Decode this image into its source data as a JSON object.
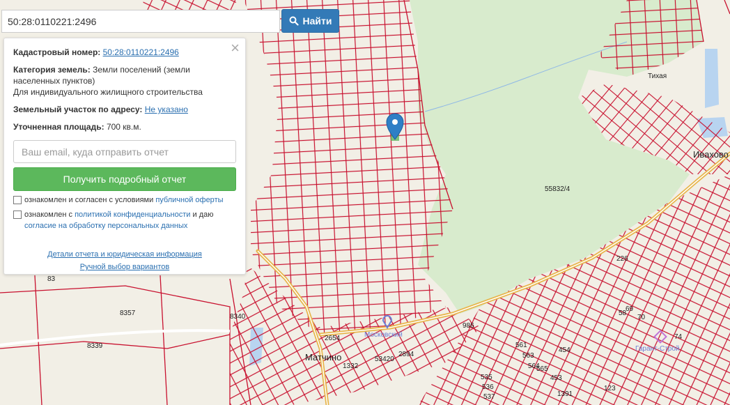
{
  "search": {
    "value": "50:28:0110221:2496",
    "button_label": "Найти"
  },
  "panel": {
    "close_glyph": "×",
    "cadastral_label": "Кадастровый номер:",
    "cadastral_value": "50:28:0110221:2496",
    "category_label": "Категория земель:",
    "category_value": "Земли поселений (земли населенных пунктов)",
    "category_use": "Для индивидуального жилищного строительства",
    "address_label": "Земельный участок по адресу:",
    "address_value": "Не указано",
    "area_label": "Уточненная площадь:",
    "area_value": "700 кв.м.",
    "email_placeholder": "Ваш email, куда отправить отчет",
    "report_button": "Получить подробный отчет",
    "agree1_text": "ознакомлен и согласен с условиями",
    "agree1_link": "публичной оферты",
    "agree2_text": "ознакомлен с",
    "agree2_link": "политикой конфиденциальности",
    "agree2_mid": "и даю",
    "agree2_link2": "согласие на обработку персональных данных",
    "details_link": "Детали отчета и юридическая информация",
    "manual_link": "Ручной выбор вариантов"
  },
  "map": {
    "colors": {
      "background": "#f2efe6",
      "forest": "#d8ebcd",
      "parcel_line": "#c8102e",
      "water": "#b8d4f0",
      "marker": "#2f7fc6"
    },
    "labels": {
      "l1": "55832/4",
      "l2": "8357",
      "l3": "8340",
      "l4": "8339",
      "l5": "2654",
      "l6": "1332",
      "l7": "986",
      "l8": "226",
      "l9": "Матчино",
      "l10": "Ивахово",
      "l11": "Московский",
      "l12": "Гарант-Строй",
      "l13": "Тихая",
      "l14": "58",
      "l15": "69",
      "l16": "70",
      "l17": "74",
      "l18": "535",
      "l19": "536",
      "l20": "537",
      "l21": "561",
      "l22": "563",
      "l23": "564",
      "l24": "565",
      "l25": "454",
      "l26": "453",
      "l27": "1391",
      "l28": "123",
      "l29": "2894",
      "l30": "53420",
      "l31": "83"
    }
  }
}
